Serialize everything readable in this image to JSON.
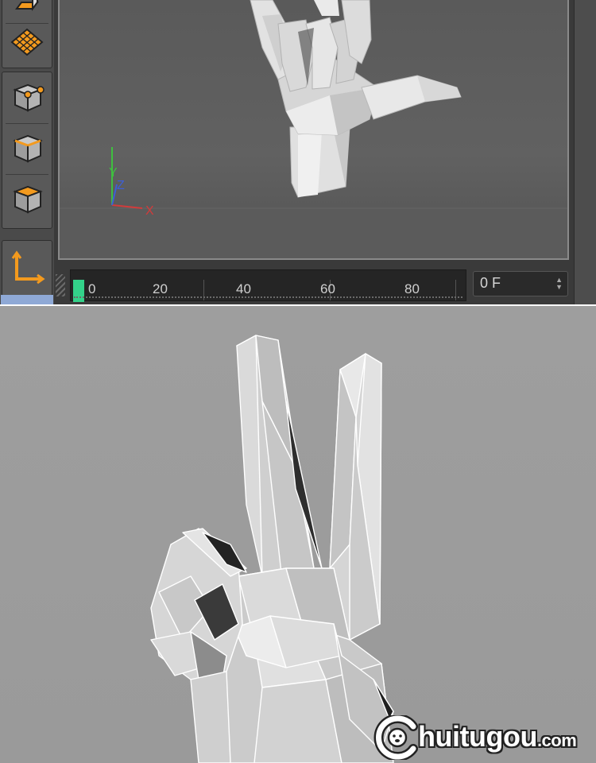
{
  "colors": {
    "accent": "#f39a1e",
    "current_frame": "#33d28a",
    "axis_x": "#d23b3b",
    "axis_y": "#3fbf3f",
    "axis_z": "#3d5fd6"
  },
  "toolbar": {
    "icons": [
      "polygon-pen-icon",
      "plane-grid-icon",
      "points-mode-icon",
      "edges-mode-icon",
      "polygons-mode-icon",
      "axis-mode-icon"
    ]
  },
  "viewport": {
    "axis_labels": {
      "x": "X",
      "y": "Y",
      "z": "Z"
    }
  },
  "timeline": {
    "ticks": [
      "0",
      "20",
      "40",
      "60",
      "80"
    ],
    "current_frame": 0,
    "frame_field_value": "0 F"
  },
  "watermark": {
    "text_main": "huitugou",
    "text_suffix": ".com"
  }
}
